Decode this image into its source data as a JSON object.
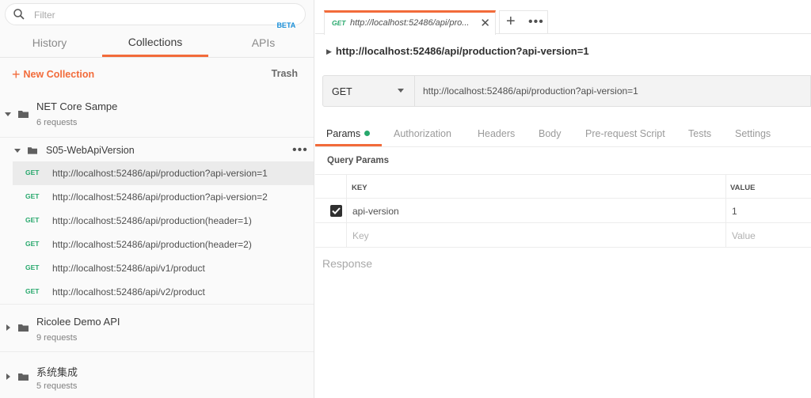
{
  "sidebar": {
    "search_placeholder": "Filter",
    "tabs": [
      {
        "label": "History"
      },
      {
        "label": "Collections"
      },
      {
        "label": "APIs",
        "badge": "BETA"
      }
    ],
    "new_collection_label": "New Collection",
    "trash_label": "Trash",
    "collections": [
      {
        "name": "NET Core Sampe",
        "count": "6 requests"
      },
      {
        "name": "Ricolee Demo API",
        "count": "9 requests"
      },
      {
        "name": "系统集成",
        "count": "5 requests"
      }
    ],
    "subfolder": {
      "name": "S05-WebApiVersion",
      "more": "•••"
    },
    "requests": [
      {
        "method": "GET",
        "url": "http://localhost:52486/api/production?api-version=1"
      },
      {
        "method": "GET",
        "url": "http://localhost:52486/api/production?api-version=2"
      },
      {
        "method": "GET",
        "url": "http://localhost:52486/api/production(header=1)"
      },
      {
        "method": "GET",
        "url": "http://localhost:52486/api/production(header=2)"
      },
      {
        "method": "GET",
        "url": "http://localhost:52486/api/v1/product"
      },
      {
        "method": "GET",
        "url": "http://localhost:52486/api/v2/product"
      }
    ]
  },
  "main": {
    "open_tab": {
      "method": "GET",
      "title": "http://localhost:52486/api/pro..."
    },
    "request_title": "http://localhost:52486/api/production?api-version=1",
    "method": "GET",
    "url": "http://localhost:52486/api/production?api-version=1",
    "subtabs": [
      {
        "label": "Params"
      },
      {
        "label": "Authorization"
      },
      {
        "label": "Headers"
      },
      {
        "label": "Body"
      },
      {
        "label": "Pre-request Script"
      },
      {
        "label": "Tests"
      },
      {
        "label": "Settings"
      }
    ],
    "query_params_label": "Query Params",
    "table": {
      "headers": {
        "key": "KEY",
        "value": "VALUE"
      },
      "rows": [
        {
          "key": "api-version",
          "value": "1",
          "checked": true
        }
      ],
      "placeholder": {
        "key": "Key",
        "value": "Value"
      }
    },
    "response_label": "Response"
  },
  "colors": {
    "accent": "#f26b3a",
    "get_method": "#27a86c",
    "beta": "#1a8fd8"
  }
}
